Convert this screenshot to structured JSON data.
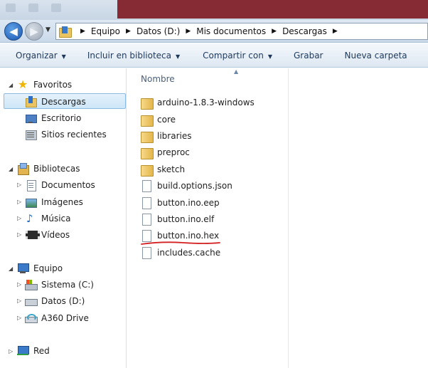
{
  "address_bar": {
    "crumbs": [
      "Equipo",
      "Datos (D:)",
      "Mis documentos",
      "Descargas"
    ]
  },
  "command_bar": {
    "organize": "Organizar",
    "include_library": "Incluir en biblioteca",
    "share_with": "Compartir con",
    "burn": "Grabar",
    "new_folder": "Nueva carpeta"
  },
  "nav_pane": {
    "favorites": {
      "header": "Favoritos",
      "items": [
        "Descargas",
        "Escritorio",
        "Sitios recientes"
      ]
    },
    "libraries": {
      "header": "Bibliotecas",
      "items": [
        "Documentos",
        "Imágenes",
        "Música",
        "Vídeos"
      ]
    },
    "computer": {
      "header": "Equipo",
      "items": [
        "Sistema (C:)",
        "Datos (D:)",
        "A360 Drive"
      ]
    },
    "network": {
      "header": "Red"
    },
    "selected": "Descargas"
  },
  "file_list": {
    "column_header": "Nombre",
    "folders": [
      "arduino-1.8.3-windows",
      "core",
      "libraries",
      "preproc",
      "sketch"
    ],
    "files": [
      "build.options.json",
      "button.ino.eep",
      "button.ino.elf",
      "button.ino.hex",
      "includes.cache"
    ],
    "highlighted_file": "button.ino.hex"
  },
  "colors": {
    "annotation_underline": "#d42020",
    "selection_border": "#8cbbe2",
    "command_text": "#1e395b"
  }
}
